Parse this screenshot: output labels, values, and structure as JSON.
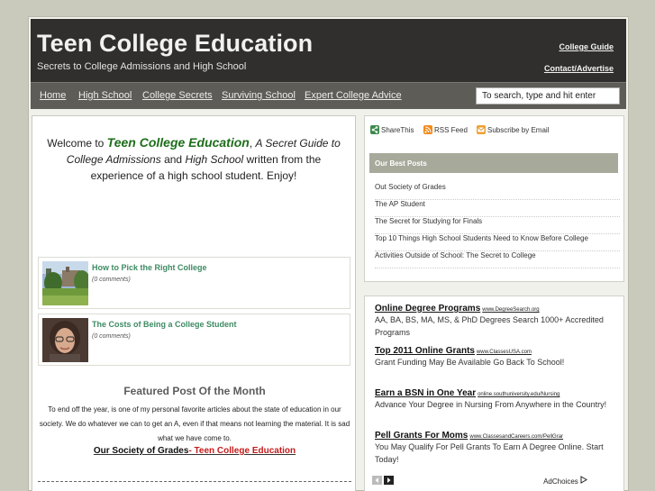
{
  "header": {
    "title": "Teen College Education",
    "tagline": "Secrets to College Admissions and High School",
    "top_links": [
      "College Guide",
      "Contact/Advertise"
    ]
  },
  "nav": {
    "items": [
      "Home",
      "High School",
      "College Secrets",
      "Surviving School",
      "Expert College Advice"
    ],
    "search_placeholder": "To search, type and hit enter"
  },
  "welcome": {
    "prefix": "Welcome to ",
    "brand": "Teen College Education",
    "comma": ", ",
    "guide": "A Secret Guide to College Admissions",
    "and": " and ",
    "hs": "High School",
    "rest": " written from the experience of a high school student. Enjoy!"
  },
  "posts": [
    {
      "title": "How to Pick the Right College",
      "comments": "(0 comments)"
    },
    {
      "title": "The Costs of Being a College Student",
      "comments": "(0 comments)"
    }
  ],
  "featured": {
    "heading": "Featured Post Of the Month",
    "body": "To end off the year, is one of my personal favorite articles about the state of education in our society. We do whatever we can to get an A, even if that means not learning the material. It is sad what we have come to.",
    "link_part1": "Our Society of Grades",
    "link_part2": "- Teen College Education"
  },
  "share": {
    "items": [
      "ShareThis",
      "RSS Feed",
      "Subscribe by Email"
    ]
  },
  "best_posts": {
    "heading": "Our Best Posts",
    "items": [
      "Out Society of Grades",
      "The AP Student",
      "The Secret for Studying for Finals",
      "Top 10 Things High School Students Need to Know Before College",
      "Activities Outside of School: The Secret to College"
    ]
  },
  "ads": {
    "items": [
      {
        "title": "Online Degree Programs",
        "url": "www.DegreeSearch.org",
        "text": "AA, BA, BS, MA, MS, & PhD Degrees Search 1000+ Accredited Programs"
      },
      {
        "title": "Top 2011 Online Grants",
        "url": "www.ClassesUSA.com",
        "text": "Grant Funding May Be Available Go Back To School!"
      },
      {
        "title": "Earn a BSN in One Year",
        "url": "online.southuniversity.edu/Nursing",
        "text": "Advance Your Degree in Nursing From Anywhere in the Country!"
      },
      {
        "title": "Pell Grants For Moms",
        "url": "www.ClassesandCareers.com/PellGrar",
        "text": "You May Qualify For Pell Grants To Earn A Degree Online. Start Today!"
      }
    ],
    "adchoices": "AdChoices"
  },
  "colors": {
    "header_bg": "#302f2d",
    "nav_bg": "#5d5c57",
    "brand_green": "#1d6e1a",
    "post_link": "#3e8a63",
    "featured_red": "#c41b1b",
    "best_head_bg": "#a7a99b"
  }
}
